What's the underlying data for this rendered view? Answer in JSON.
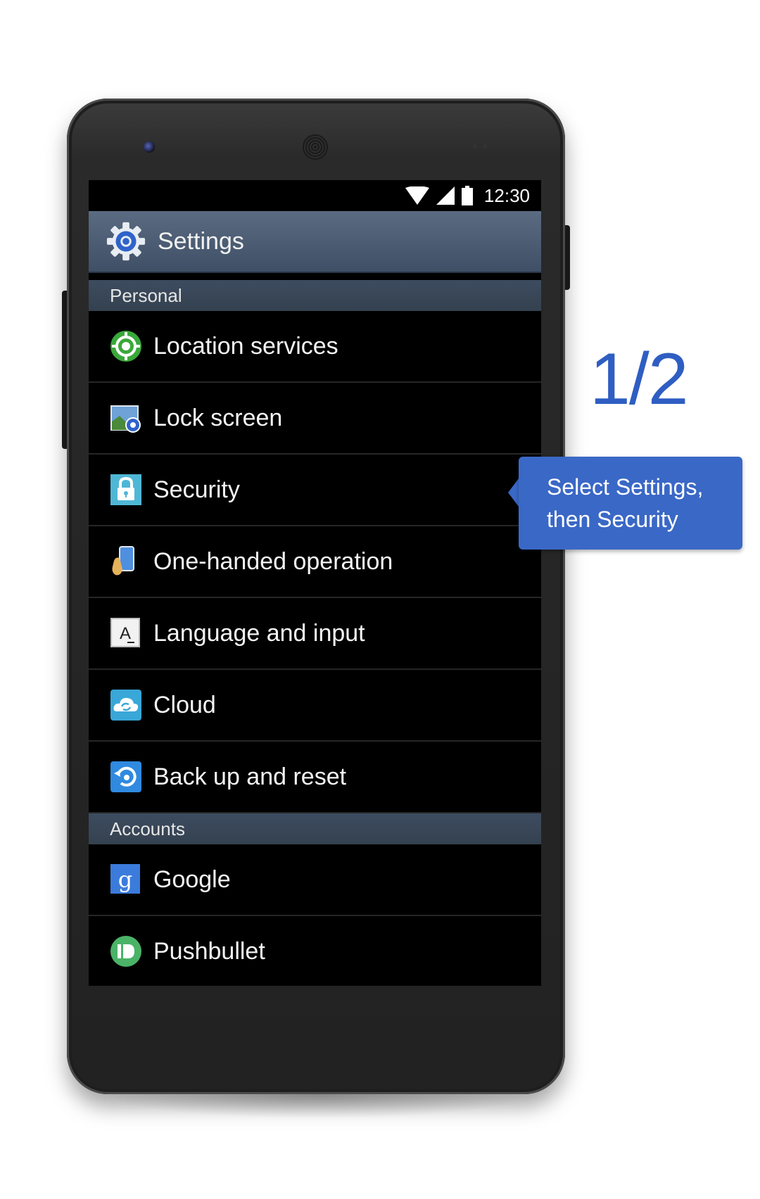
{
  "status_bar": {
    "time": "12:30",
    "icons": [
      "wifi-icon",
      "signal-icon",
      "battery-icon"
    ]
  },
  "action_bar": {
    "icon": "settings-gear-icon",
    "title": "Settings"
  },
  "sections": {
    "personal": {
      "header": "Personal",
      "items": [
        {
          "label": "Location services",
          "icon": "location-icon"
        },
        {
          "label": "Lock screen",
          "icon": "lock-screen-icon"
        },
        {
          "label": "Security",
          "icon": "padlock-icon"
        },
        {
          "label": "One-handed operation",
          "icon": "hand-phone-icon"
        },
        {
          "label": "Language and input",
          "icon": "language-a-icon"
        },
        {
          "label": "Cloud",
          "icon": "cloud-icon"
        },
        {
          "label": "Back up and reset",
          "icon": "backup-reset-icon"
        }
      ]
    },
    "accounts": {
      "header": "Accounts",
      "items": [
        {
          "label": "Google",
          "icon": "google-g-icon"
        },
        {
          "label": "Pushbullet",
          "icon": "pushbullet-icon"
        }
      ]
    }
  },
  "tutorial": {
    "step": "1/2",
    "tooltip": "Select Settings, then Security"
  },
  "colors": {
    "accent": "#3a68c6",
    "step_text": "#2f5ec2",
    "action_bar": "#4a5b72",
    "section_header": "#3a4859"
  }
}
